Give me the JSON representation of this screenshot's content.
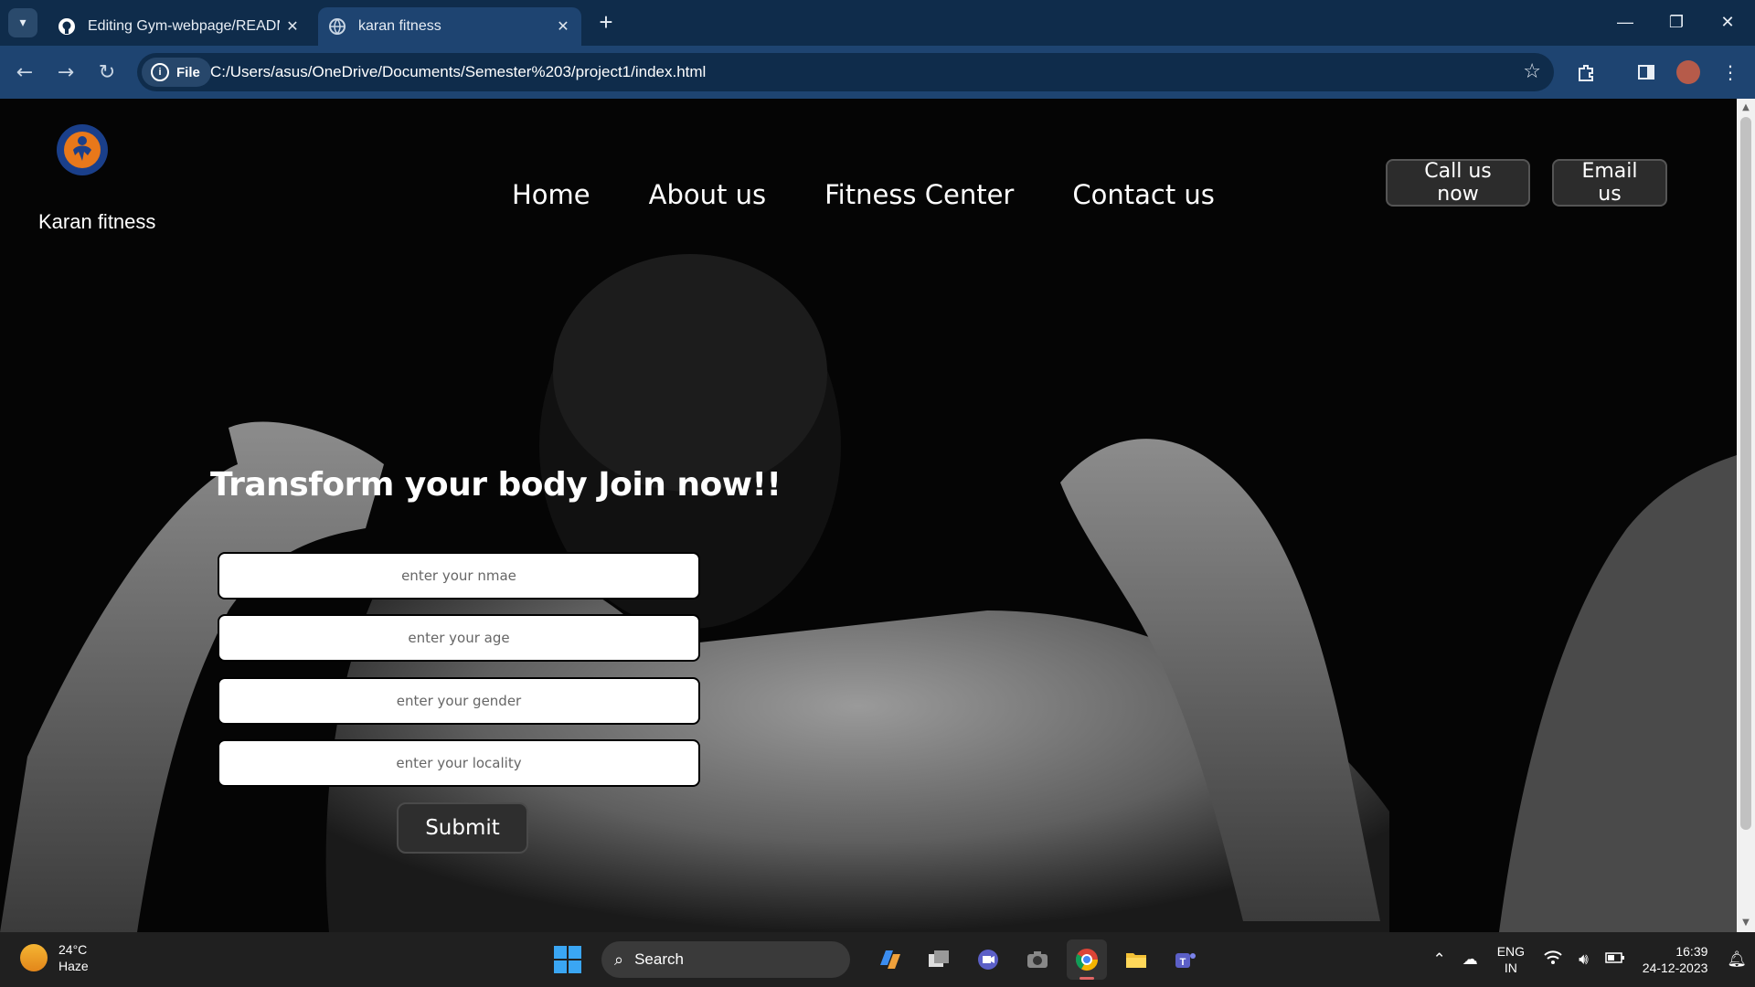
{
  "browser": {
    "tabs": [
      {
        "title": "Editing Gym-webpage/READM",
        "icon": "github-icon",
        "active": false
      },
      {
        "title": "karan fitness",
        "icon": "globe-icon",
        "active": true
      }
    ],
    "address": {
      "scheme_label": "File",
      "url": "C:/Users/asus/OneDrive/Documents/Semester%203/project1/index.html"
    }
  },
  "site": {
    "brand": "Karan fitness",
    "nav": [
      "Home",
      "About us",
      "Fitness Center",
      "Contact us"
    ],
    "cta": {
      "call": "Call us now",
      "email": "Email us"
    },
    "headline": "Transform your body Join now!!",
    "form": {
      "name_placeholder": "enter your nmae",
      "age_placeholder": "enter your age",
      "gender_placeholder": "enter your gender",
      "locality_placeholder": "enter your locality",
      "submit_label": "Submit"
    }
  },
  "taskbar": {
    "weather": {
      "temp": "24°C",
      "condition": "Haze"
    },
    "search_label": "Search",
    "apps": [
      "copilot-icon",
      "task-view-icon",
      "meet-icon",
      "camera-icon",
      "chrome-icon",
      "file-explorer-icon",
      "teams-icon"
    ],
    "language": {
      "line1": "ENG",
      "line2": "IN"
    },
    "clock": {
      "time": "16:39",
      "date": "24-12-2023"
    }
  },
  "colors": {
    "browser_frame": "#0f2c4b",
    "toolbar": "#1e4471",
    "cta_bg": "#2c2c2c",
    "taskbar": "#202020"
  }
}
